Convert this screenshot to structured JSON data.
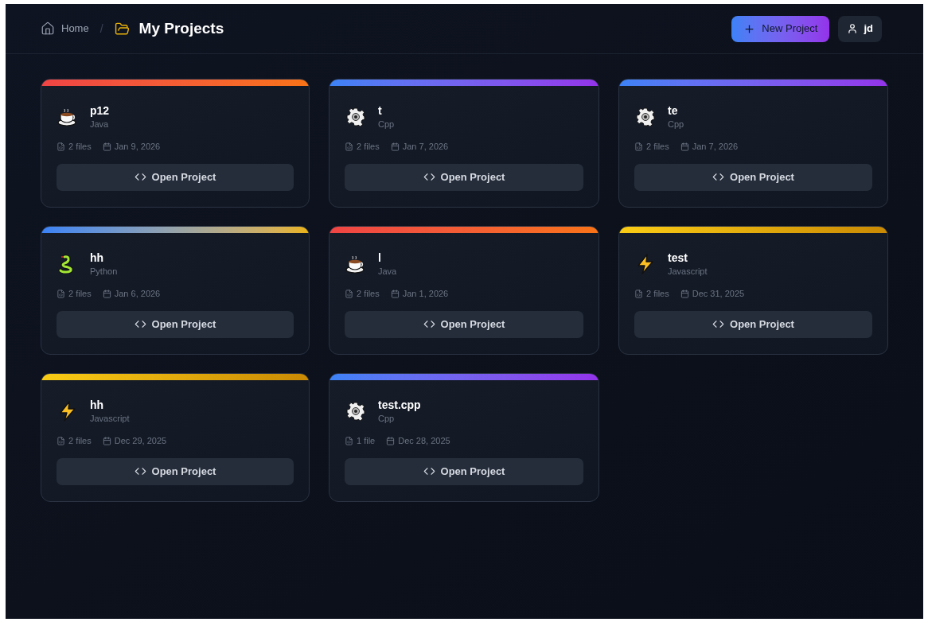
{
  "breadcrumb": {
    "home": "Home",
    "separator": "/",
    "current": "My Projects"
  },
  "header": {
    "new_project": "New Project",
    "user": "jd"
  },
  "projects": [
    {
      "name": "p12",
      "language": "Java",
      "kind": "java",
      "files": "2 files",
      "date": "Jan 9, 2026",
      "action": "Open Project"
    },
    {
      "name": "t",
      "language": "Cpp",
      "kind": "cpp",
      "files": "2 files",
      "date": "Jan 7, 2026",
      "action": "Open Project"
    },
    {
      "name": "te",
      "language": "Cpp",
      "kind": "cpp",
      "files": "2 files",
      "date": "Jan 7, 2026",
      "action": "Open Project"
    },
    {
      "name": "hh",
      "language": "Python",
      "kind": "python",
      "files": "2 files",
      "date": "Jan 6, 2026",
      "action": "Open Project"
    },
    {
      "name": "l",
      "language": "Java",
      "kind": "java",
      "files": "2 files",
      "date": "Jan 1, 2026",
      "action": "Open Project"
    },
    {
      "name": "test",
      "language": "Javascript",
      "kind": "javascript",
      "files": "2 files",
      "date": "Dec 31, 2025",
      "action": "Open Project"
    },
    {
      "name": "hh",
      "language": "Javascript",
      "kind": "javascript",
      "files": "2 files",
      "date": "Dec 29, 2025",
      "action": "Open Project"
    },
    {
      "name": "test.cpp",
      "language": "Cpp",
      "kind": "cpp",
      "files": "1 file",
      "date": "Dec 28, 2025",
      "action": "Open Project"
    }
  ]
}
